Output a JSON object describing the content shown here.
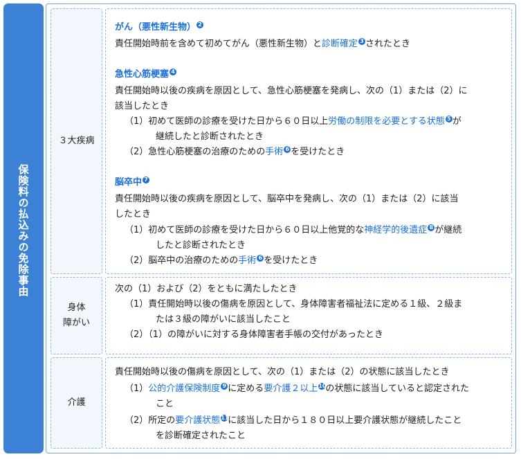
{
  "side_label": "保険料の払込みの免除事由",
  "rows": {
    "r1": {
      "label": "３大疾病",
      "s1": {
        "title": "がん（悪性新生物）",
        "title_num": "2",
        "l1a": "責任開始時前を含めて初めてがん（悪性新生物）と",
        "l1link": "診断確定",
        "l1num": "3",
        "l1b": "されたとき"
      },
      "s2": {
        "title": "急性心筋梗塞",
        "title_num": "4",
        "l1": "責任開始時以後の疾病を原因として、急性心筋梗塞を発病し、次の（1）または（2）に",
        "l2": "該当したとき",
        "i1a": "（1）初めて医師の診療を受けた日から６０日以上",
        "i1link": "労働の制限を必要とする状態",
        "i1num": "5",
        "i1b": "が",
        "i1c": "継続したと診断されたとき",
        "i2a": "（2）急性心筋梗塞の治療のための",
        "i2link": "手術",
        "i2num": "6",
        "i2b": "を受けたとき"
      },
      "s3": {
        "title": "脳卒中",
        "title_num": "7",
        "l1": "責任開始時以後の疾病を原因として、脳卒中を発病し、次の（1）または（2）に該当",
        "l2": "したとき",
        "i1a": "（1）初めて医師の診療を受けた日から６０日以上他覚的な",
        "i1link": "神経学的後遺症",
        "i1num": "8",
        "i1b": "が継続",
        "i1c": "したと診断されたとき",
        "i2a": "（2）脳卒中の治療のための",
        "i2link": "手術",
        "i2num": "6",
        "i2b": "を受けたとき"
      }
    },
    "r2": {
      "label1": "身体",
      "label2": "障がい",
      "l1": "次の（1）および（2）をともに満たしたとき",
      "i1a": "（1）責任開始時以後の傷病を原因として、身体障害者福祉法に定める１級、２級ま",
      "i1b": "たは３級の障がいに該当したこと",
      "i2": "（2）（1）の障がいに対する身体障害者手帳の交付があったとき"
    },
    "r3": {
      "label": "介護",
      "l1": "責任開始時以後の傷病を原因として、次の（1）または（2）の状態に該当したとき",
      "i1pre": "（1）",
      "i1link1": "公的介護保険制度",
      "i1num1": "9",
      "i1mid": "に定める",
      "i1link2": "要介護２以上",
      "i1num2": "10",
      "i1b": "の状態に該当していると認定された",
      "i1c": "こと",
      "i2a": "（2）所定の",
      "i2link": "要介護状態",
      "i2num": "11",
      "i2b": "に該当した日から１８０日以上要介護状態が継続したこと",
      "i2c": "を診断確定されたこと"
    }
  }
}
